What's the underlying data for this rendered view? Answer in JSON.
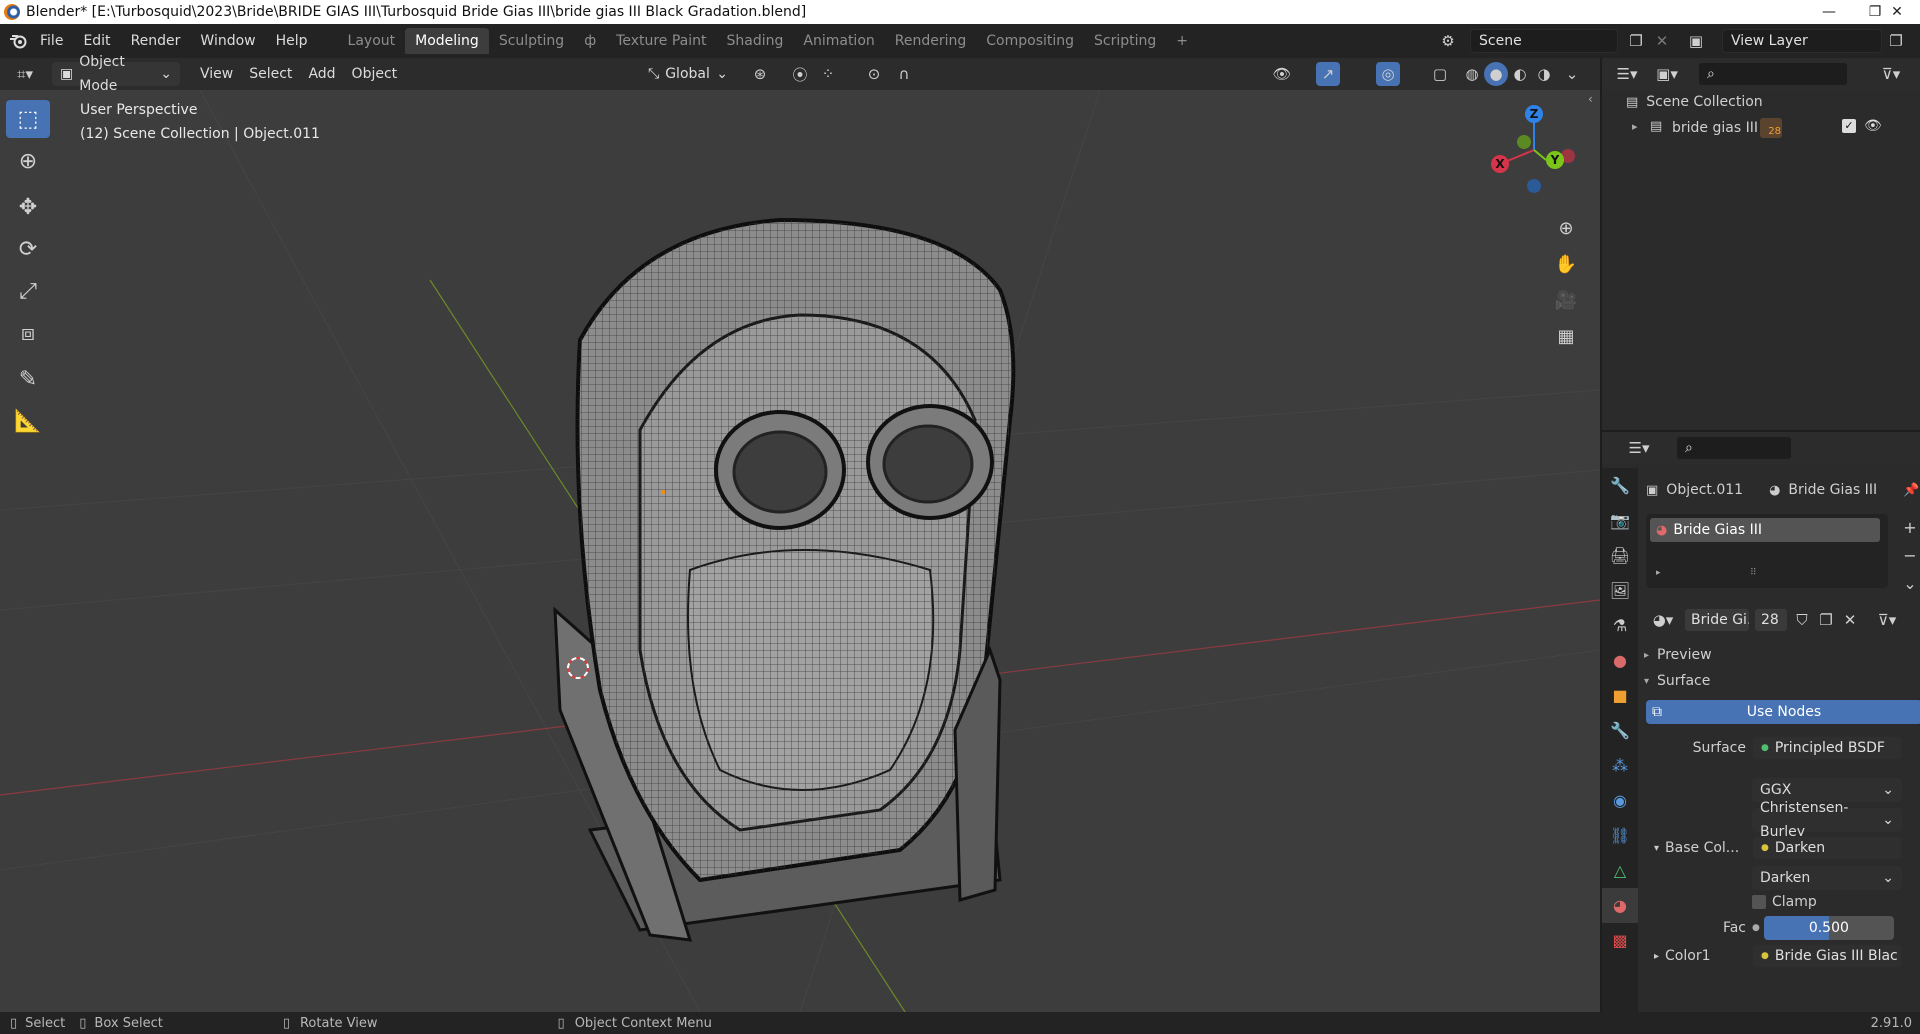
{
  "window": {
    "title": "Blender* [E:\\Turbosquid\\2023\\Bride\\BRIDE GIAS III\\Turbosquid Bride Gias III\\bride gias III Black Gradation.blend]",
    "controls": [
      "—",
      "❐",
      "✕"
    ]
  },
  "menu": [
    "File",
    "Edit",
    "Render",
    "Window",
    "Help"
  ],
  "workspaces": [
    {
      "label": "Layout",
      "active": false
    },
    {
      "label": "Modeling",
      "active": true
    },
    {
      "label": "Sculpting",
      "active": false
    },
    {
      "label": "ф",
      "active": false
    },
    {
      "label": "Texture Paint",
      "active": false
    },
    {
      "label": "Shading",
      "active": false
    },
    {
      "label": "Animation",
      "active": false
    },
    {
      "label": "Rendering",
      "active": false
    },
    {
      "label": "Compositing",
      "active": false
    },
    {
      "label": "Scripting",
      "active": false
    }
  ],
  "add_workspace": "+",
  "scene": {
    "name": "Scene",
    "view_layer": "View Layer"
  },
  "viewport_header": {
    "mode": "Object Mode",
    "menus": [
      "View",
      "Select",
      "Add",
      "Object"
    ],
    "transform_orientation": "Global"
  },
  "viewport": {
    "line1": "User Perspective",
    "line2": "(12) Scene Collection | Object.011",
    "gizmo": {
      "z": "Z",
      "x": "X",
      "y": "Y"
    },
    "accent_colors": {
      "x": "#d5344a",
      "y": "#7bc51b",
      "z": "#2f83e6"
    }
  },
  "outliner": {
    "root": "Scene Collection",
    "items": [
      {
        "label": "bride gias III",
        "badge": "28"
      }
    ]
  },
  "properties": {
    "object": "Object.011",
    "material": "Bride Gias III",
    "slot": "Bride Gias III",
    "material_field": "Bride Gi...",
    "users": "28",
    "panel_preview": "Preview",
    "panel_surface": "Surface",
    "use_nodes": "Use Nodes",
    "surface_label": "Surface",
    "surface_value": "Principled BSDF",
    "distribution": "GGX",
    "subsurface": "Christensen-Burley",
    "base_color_label": "Base Col...",
    "base_color_value": "Darken",
    "blend_mode": "Darken",
    "clamp": "Clamp",
    "fac_label": "Fac",
    "fac_value": "0.500",
    "fac_fraction": 0.5,
    "color1_label": "Color1",
    "color1_value": "Bride Gias III Blac"
  },
  "statusbar": {
    "select": "Select",
    "box_select": "Box Select",
    "rotate_view": "Rotate View",
    "context_menu": "Object Context Menu",
    "version": "2.91.0"
  }
}
